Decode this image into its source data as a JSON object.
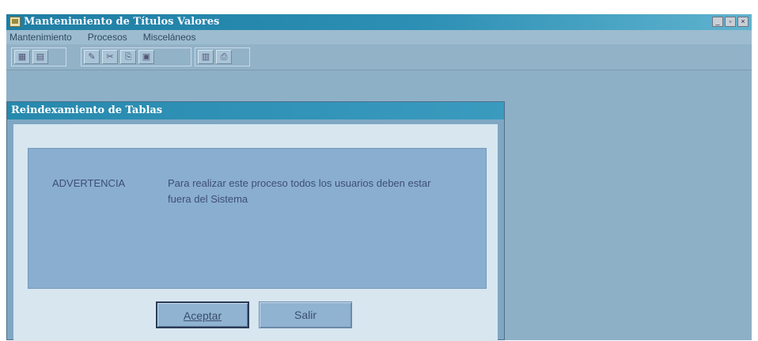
{
  "window": {
    "title": "Mantenimiento de Títulos Valores",
    "buttons": [
      "_",
      "▫",
      "×"
    ]
  },
  "menu": {
    "items": [
      "Mantenimiento",
      "Procesos",
      "Misceláneos"
    ]
  },
  "toolbar": {
    "group1": [
      "▦",
      "▤"
    ],
    "group2": [
      "✎",
      "✂",
      "⎘",
      "▣"
    ],
    "group3": [
      "▥",
      "⎙"
    ]
  },
  "dialog": {
    "title": "Reindexamiento de Tablas",
    "warning_label": "ADVERTENCIA",
    "warning_message": "Para realizar este proceso todos los usuarios deben estar fuera del Sistema",
    "accept_label": "Aceptar",
    "exit_label": "Salir"
  }
}
